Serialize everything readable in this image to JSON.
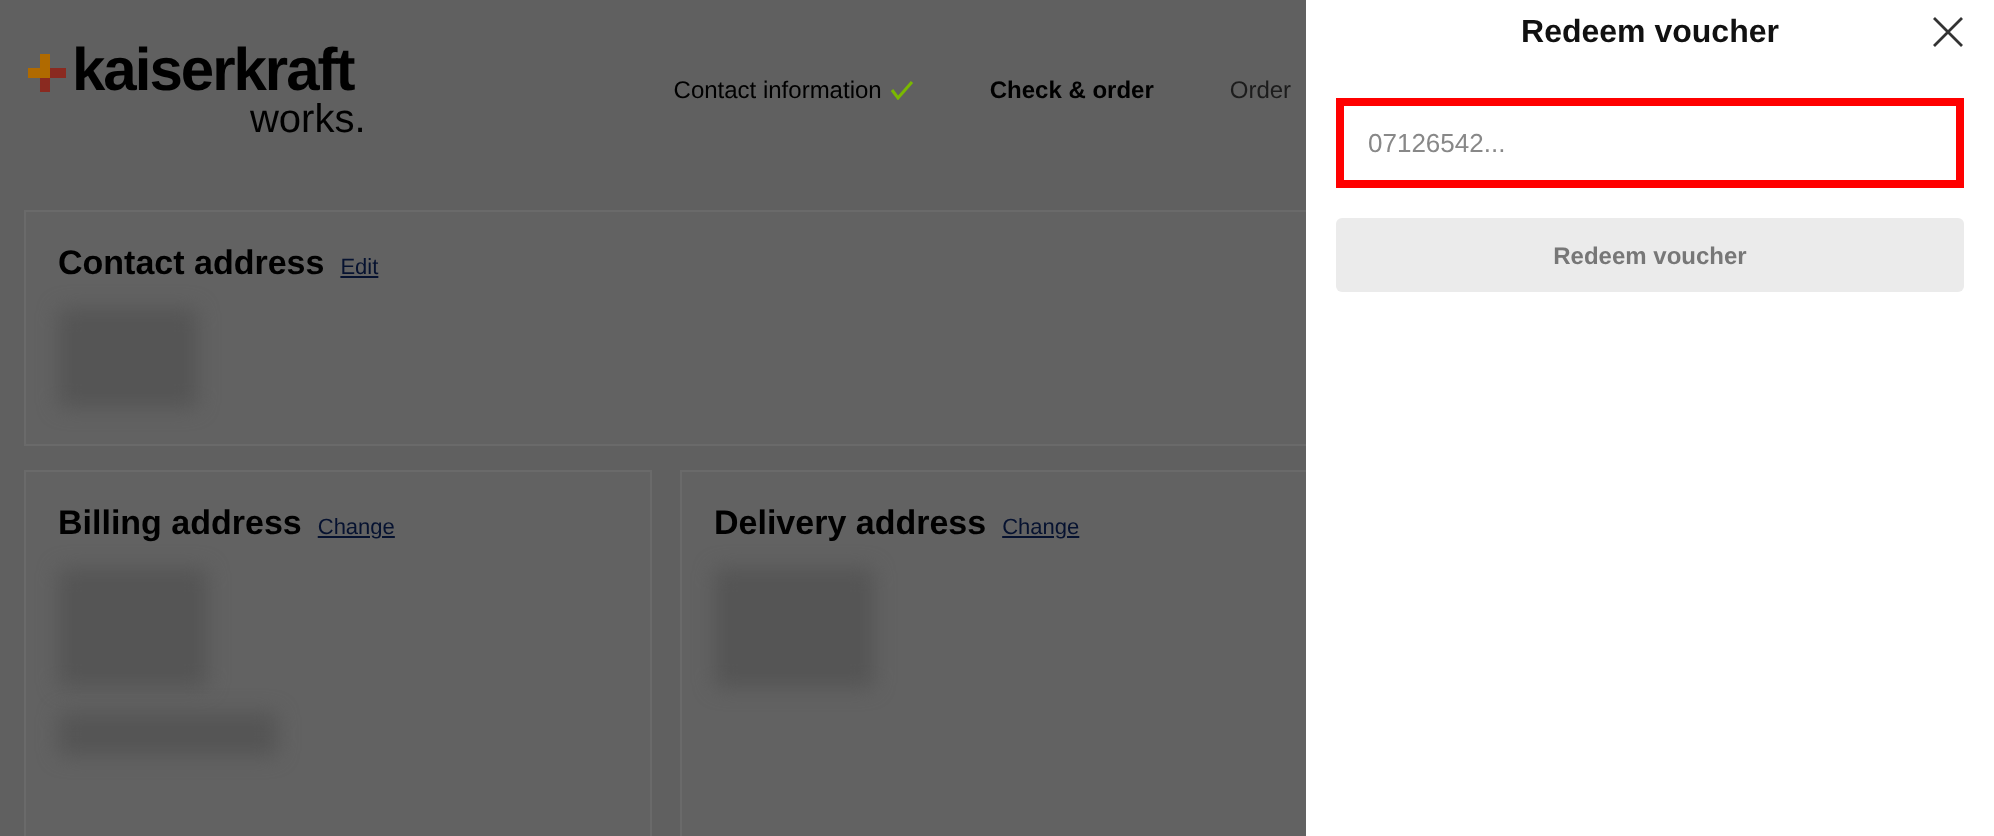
{
  "logo": {
    "brand": "kaiserkraft",
    "tagline": "works."
  },
  "steps": [
    {
      "label": "Contact information",
      "completed": true,
      "selected": false
    },
    {
      "label": "Check & order",
      "completed": false,
      "selected": true
    },
    {
      "label": "Order",
      "completed": false,
      "selected": false
    }
  ],
  "contact_address": {
    "title": "Contact address",
    "link": "Edit"
  },
  "billing_address": {
    "title": "Billing address",
    "link": "Change"
  },
  "delivery_address": {
    "title": "Delivery address",
    "link": "Change"
  },
  "drawer": {
    "title": "Redeem voucher",
    "field": {
      "placeholder": "07126542...",
      "error": true
    },
    "button": {
      "label": "Redeem voucher",
      "disabled": true
    }
  }
}
